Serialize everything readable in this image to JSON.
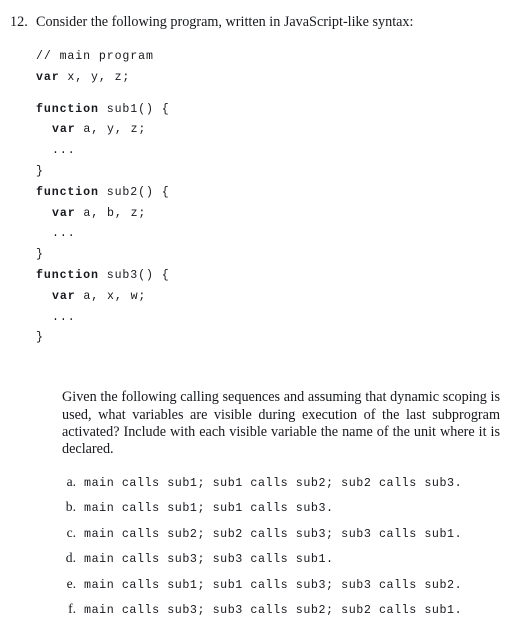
{
  "exercise": {
    "number": "12.",
    "stem": "Consider the following program, written in JavaScript-like syntax:",
    "code_lines": [
      {
        "indent": 0,
        "keyword": "",
        "rest": "// main program"
      },
      {
        "indent": 0,
        "keyword": "var",
        "rest": " x, y, z;"
      },
      {
        "indent": 0,
        "keyword": "",
        "rest": ""
      },
      {
        "indent": 0,
        "keyword": "function",
        "rest": " sub1() {"
      },
      {
        "indent": 1,
        "keyword": "var",
        "rest": " a, y, z;"
      },
      {
        "indent": 1,
        "keyword": "",
        "rest": "..."
      },
      {
        "indent": 0,
        "keyword": "",
        "rest": "}"
      },
      {
        "indent": 0,
        "keyword": "function",
        "rest": " sub2() {"
      },
      {
        "indent": 1,
        "keyword": "var",
        "rest": " a, b, z;"
      },
      {
        "indent": 1,
        "keyword": "",
        "rest": "..."
      },
      {
        "indent": 0,
        "keyword": "",
        "rest": "}"
      },
      {
        "indent": 0,
        "keyword": "function",
        "rest": " sub3() {"
      },
      {
        "indent": 1,
        "keyword": "var",
        "rest": " a, x, w;"
      },
      {
        "indent": 1,
        "keyword": "",
        "rest": "..."
      },
      {
        "indent": 0,
        "keyword": "",
        "rest": "}"
      }
    ],
    "prompt": "Given the following calling sequences and assuming that dynamic scoping is used, what variables are visible during execution of the last subprogram activated? Include with each visible variable the name of the unit where it is declared.",
    "choices": [
      {
        "marker": "a.",
        "text": "main calls sub1; sub1 calls sub2; sub2 calls sub3."
      },
      {
        "marker": "b.",
        "text": "main calls sub1; sub1 calls sub3."
      },
      {
        "marker": "c.",
        "text": "main calls sub2; sub2 calls sub3; sub3 calls sub1."
      },
      {
        "marker": "d.",
        "text": "main calls sub3; sub3 calls sub1."
      },
      {
        "marker": "e.",
        "text": "main calls sub1; sub1 calls sub3; sub3 calls sub2."
      },
      {
        "marker": "f.",
        "text": "main calls sub3; sub3 calls sub2; sub2 calls sub1."
      }
    ]
  },
  "colors": {
    "page_background": "#ffffff",
    "text": "#16181d"
  }
}
